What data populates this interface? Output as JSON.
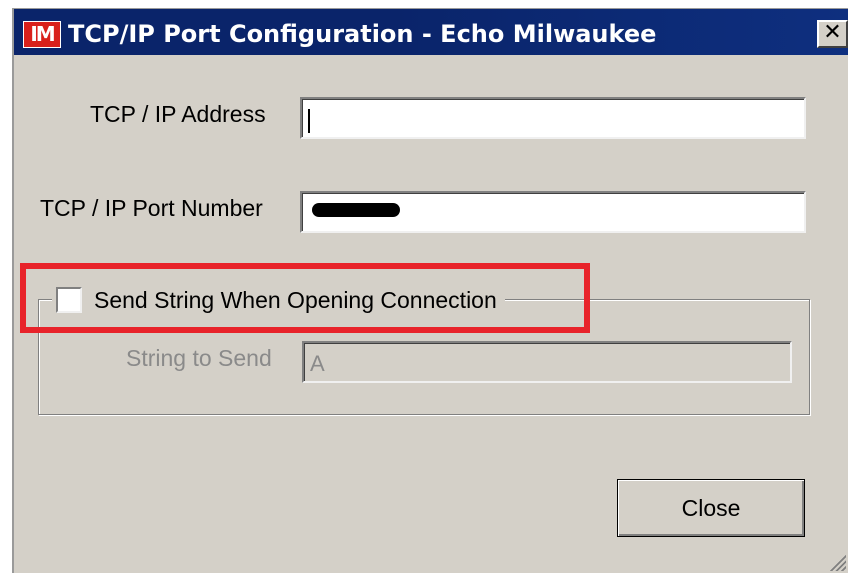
{
  "window": {
    "title": "TCP/IP Port Configuration - Echo Milwaukee",
    "icon_text": "IM",
    "close_glyph": "✕"
  },
  "fields": {
    "address_label": "TCP / IP Address",
    "address_value": "",
    "port_label": "TCP / IP Port Number",
    "port_value": "",
    "string_label": "String to Send",
    "string_value": "A"
  },
  "group": {
    "checkbox_label": "Send String When Opening Connection",
    "checked": false
  },
  "buttons": {
    "close_label": "Close"
  },
  "colors": {
    "title_bar": "#0a246a",
    "highlight": "#e8232a",
    "face": "#d4d0c8"
  }
}
